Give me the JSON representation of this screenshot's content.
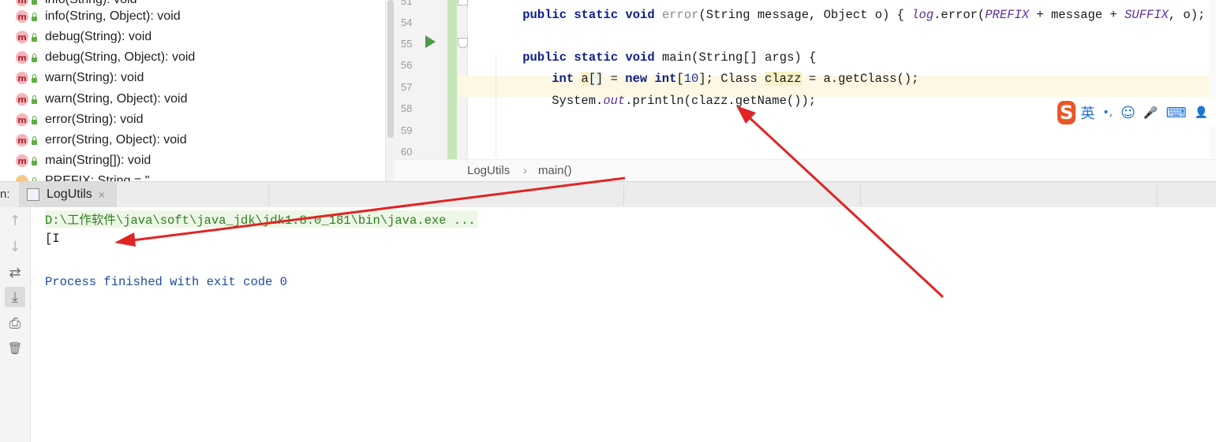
{
  "structure": {
    "items": [
      {
        "label": "info(String, Object): void",
        "kind": "m"
      },
      {
        "label": "debug(String): void",
        "kind": "m"
      },
      {
        "label": "debug(String, Object): void",
        "kind": "m"
      },
      {
        "label": "warn(String): void",
        "kind": "m"
      },
      {
        "label": "warn(String, Object): void",
        "kind": "m"
      },
      {
        "label": "error(String): void",
        "kind": "m"
      },
      {
        "label": "error(String, Object): void",
        "kind": "m"
      },
      {
        "label": "main(String[]): void",
        "kind": "m"
      }
    ],
    "partial_top": "info(String): void",
    "partial_bottom": "PREFIX: String = \"",
    "method_badge": "m"
  },
  "editor": {
    "line_numbers": [
      "51",
      "54",
      "55",
      "56",
      "57",
      "58",
      "59",
      "60"
    ],
    "code": {
      "l51": {
        "mod": "public static void ",
        "name": "error",
        "params": "(String message, Object o) { ",
        "log": "log",
        "call": ".error(",
        "prefix": "PREFIX",
        "plus1": " + message + ",
        "suffix": "SUFFIX",
        "end": ", o); }"
      },
      "l55": {
        "kw": "public static void ",
        "rest": "main(String[] args) {"
      },
      "l56": {
        "kw1": "int ",
        "a": "a",
        "br": "[]",
        "eq": " = ",
        "kw2": "new ",
        "kw3": "int",
        "lb": "[",
        "num": "10",
        "rb": "]",
        "mid": "; Class ",
        "var": "clazz",
        "end": " = a.getClass();"
      },
      "l57": {
        "sys": "System.",
        "out": "out",
        "rest": ".println(clazz.getName());"
      }
    },
    "breadcrumb": {
      "class": "LogUtils",
      "sep": "›",
      "method": "main()"
    }
  },
  "ime": {
    "logo": "S",
    "lang": "英",
    "punct": "•,",
    "emoji": "☺",
    "mic": "🎤",
    "keyboard": "⌨",
    "user": "👤"
  },
  "run": {
    "label": "n:",
    "tab_label": "LogUtils",
    "tab_close": "×",
    "toolbar": {
      "up": "↑",
      "down": "↓",
      "wrap": "⇄",
      "scroll_end": "⤓",
      "print": "⎙",
      "trash": "🗑"
    },
    "console": {
      "command": "D:\\工作软件\\java\\soft\\java_jdk\\jdk1.8.0_181\\bin\\java.exe ...",
      "output": "[I",
      "exit": "Process finished with exit code 0"
    }
  },
  "colors": {
    "arrow": "#e02424",
    "keyword": "#0b1e8c",
    "console_cmd": "#2d7f1f",
    "console_exit": "#1d4ca0"
  }
}
